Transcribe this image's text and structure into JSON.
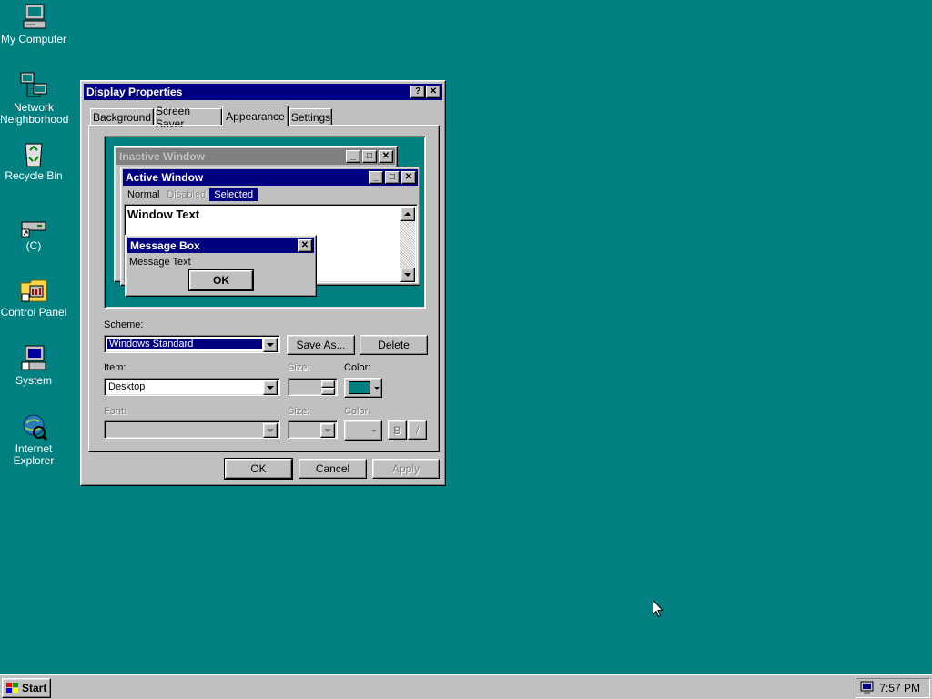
{
  "desktop": {
    "icons": [
      {
        "label": "My Computer"
      },
      {
        "label": "Network Neighborhood"
      },
      {
        "label": "Recycle Bin"
      },
      {
        "label": "(C)"
      },
      {
        "label": "Control Panel"
      },
      {
        "label": "System"
      },
      {
        "label": "Internet Explorer"
      }
    ]
  },
  "dialog": {
    "title": "Display Properties",
    "help_label": "?",
    "close_label": "✕",
    "tabs": [
      {
        "label": "Background"
      },
      {
        "label": "Screen Saver"
      },
      {
        "label": "Appearance"
      },
      {
        "label": "Settings"
      }
    ],
    "preview": {
      "inactive_title": "Inactive Window",
      "active_title": "Active Window",
      "menu_normal": "Normal",
      "menu_disabled": "Disabled",
      "menu_selected": "Selected",
      "window_text": "Window Text",
      "msgbox_title": "Message Box",
      "msgbox_text": "Message Text",
      "msgbox_ok": "OK"
    },
    "scheme_label": "Scheme:",
    "scheme_value": "Windows Standard",
    "save_as_label": "Save As...",
    "delete_label": "Delete",
    "item_label": "Item:",
    "item_value": "Desktop",
    "size_label": "Size:",
    "color_label": "Color:",
    "font_label": "Font:",
    "font_size_label": "Size:",
    "font_color_label": "Color:",
    "bold_label": "B",
    "italic_label": "/",
    "ok_label": "OK",
    "cancel_label": "Cancel",
    "apply_label": "Apply"
  },
  "taskbar": {
    "start_label": "Start",
    "clock": "7:57 PM"
  },
  "colors": {
    "desktop": "#008080",
    "active_title": "#000080",
    "inactive_title": "#808080",
    "face": "#c0c0c0"
  }
}
